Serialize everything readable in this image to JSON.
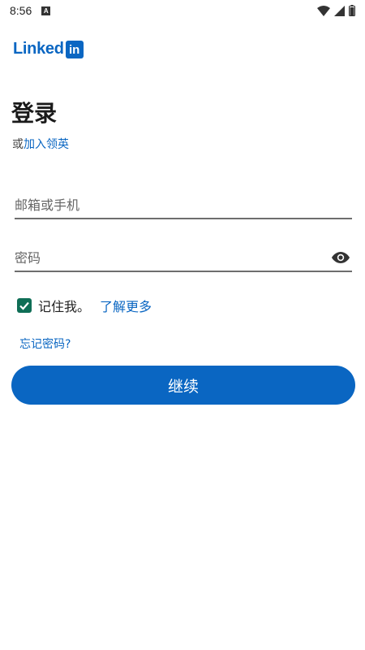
{
  "status_bar": {
    "time": "8:56",
    "notification_icon": "a-notification-icon",
    "icons": [
      "wifi-icon",
      "signal-icon",
      "battery-icon"
    ]
  },
  "logo": {
    "text": "Linked",
    "box_text": "in",
    "color": "#0a66c2"
  },
  "title": "登录",
  "join": {
    "prefix": "或",
    "link": "加入领英"
  },
  "email": {
    "placeholder": "邮箱或手机",
    "value": ""
  },
  "password": {
    "placeholder": "密码",
    "value": ""
  },
  "remember": {
    "label": "记住我。",
    "checked": true,
    "learn_more": "了解更多"
  },
  "forgot_password": "忘记密码?",
  "continue_button": "继续",
  "colors": {
    "brand": "#0a66c2",
    "checkbox": "#0f6e56"
  }
}
